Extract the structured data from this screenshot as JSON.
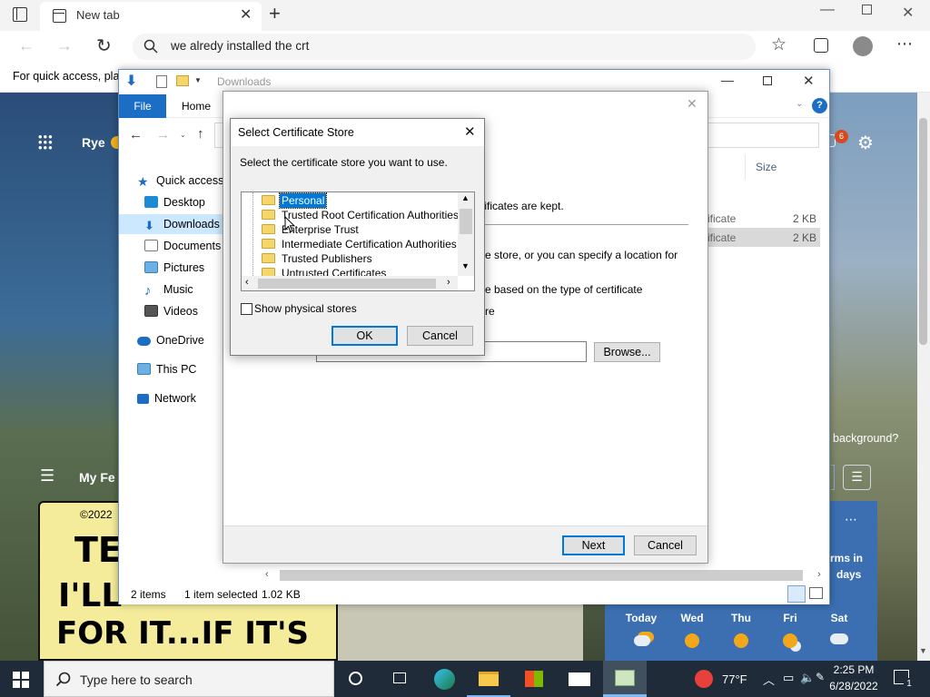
{
  "browser": {
    "tab_title": "New tab",
    "address_text": "we alredy installed the crt",
    "favorites_hint": "For quick access, plac"
  },
  "newtab": {
    "location": "Rye",
    "feed_label": "My Fe",
    "notification_count": "6",
    "background_question": "background?",
    "comic_text_1": "©2022",
    "comic_text_2": "TE",
    "comic_text_3": "I'LL",
    "comic_text_4": "FOR IT...IF IT'S",
    "weather_note_1": "rms in",
    "weather_note_2": "days",
    "forecast": [
      {
        "day": "Today",
        "icon": "partly-sunny-icon"
      },
      {
        "day": "Wed",
        "icon": "sunny-icon"
      },
      {
        "day": "Thu",
        "icon": "sunny-icon"
      },
      {
        "day": "Fri",
        "icon": "partly-sunny-icon"
      },
      {
        "day": "Sat",
        "icon": "rain-icon"
      }
    ]
  },
  "explorer": {
    "title": "Downloads",
    "ribbon_file": "File",
    "ribbon_home": "Home",
    "nav": {
      "quick_access": "Quick access",
      "desktop": "Desktop",
      "downloads": "Downloads",
      "documents": "Documents",
      "pictures": "Pictures",
      "music": "Music",
      "videos": "Videos",
      "onedrive": "OneDrive",
      "this_pc": "This PC",
      "network": "Network"
    },
    "size_header": "Size",
    "files": [
      {
        "name": "ificate",
        "size": "2 KB"
      },
      {
        "name": "ificate",
        "size": "2 KB"
      }
    ],
    "status": {
      "items": "2 items",
      "selected": "1 item selected",
      "size": "1.02 KB"
    }
  },
  "wizard": {
    "text_1": "tificates are kept.",
    "text_2": "e store, or you can specify a location for",
    "text_3": "e based on the type of certificate",
    "text_4": "re",
    "browse_label": "Browse...",
    "next_label": "Next",
    "cancel_label": "Cancel"
  },
  "dialog": {
    "title": "Select Certificate Store",
    "prompt": "Select the certificate store you want to use.",
    "stores": [
      "Personal",
      "Trusted Root Certification Authorities",
      "Enterprise Trust",
      "Intermediate Certification Authorities",
      "Trusted Publishers",
      "Untrusted Certificates"
    ],
    "selected_store": "Personal",
    "show_physical_label": "Show physical stores",
    "show_physical_checked": false,
    "ok_label": "OK",
    "cancel_label": "Cancel"
  },
  "taskbar": {
    "search_placeholder": "Type here to search",
    "temperature": "77°F",
    "time": "2:25 PM",
    "date": "6/28/2022",
    "notification_badge": "1"
  }
}
